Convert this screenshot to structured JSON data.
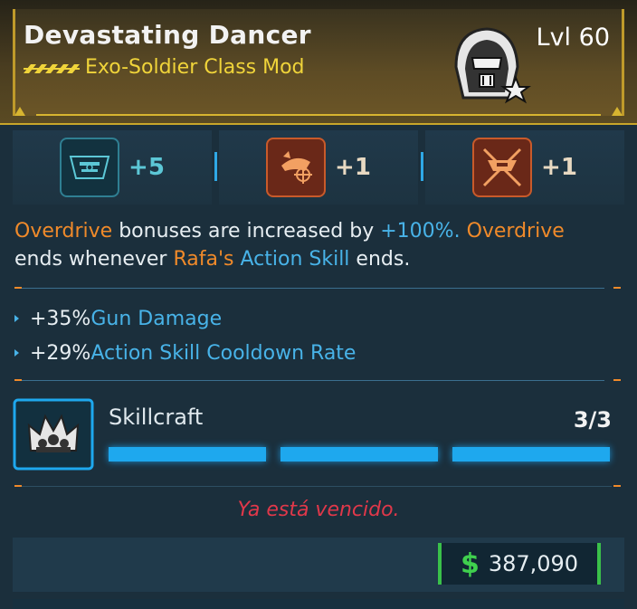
{
  "item": {
    "name": "Devastating Dancer",
    "type": "Exo-Soldier Class Mod",
    "level": "Lvl 60",
    "rarity_icon": "rarity-chevrons-icon",
    "class_emblem": "exo-soldier-helmet-icon",
    "rarity_color": "#f0d43a"
  },
  "stats": [
    {
      "icon": "skill-node-teal-icon",
      "value": "+5",
      "color": "#5cc7d6"
    },
    {
      "icon": "skill-node-orange-target-icon",
      "value": "+1",
      "color": "#e8d9c2"
    },
    {
      "icon": "skill-node-orange-crossed-icon",
      "value": "+1",
      "color": "#e8d9c2"
    }
  ],
  "description": {
    "p1_a": "Overdrive",
    "p1_b": " bonuses are increased by ",
    "p1_c": "+100%",
    "p1_d": ". ",
    "p1_e": "Overdrive",
    "p2_a": "ends whenever ",
    "p2_b": "Rafa's",
    "p2_c": " ",
    "p2_d": "Action Skill",
    "p2_e": " ends."
  },
  "bonuses": [
    {
      "amount": "+35% ",
      "label": "Gun Damage"
    },
    {
      "amount": "+29% ",
      "label": "Action Skill Cooldown Rate"
    }
  ],
  "skillcraft": {
    "label": "Skillcraft",
    "count": "3/3",
    "filled": 3,
    "total": 3,
    "icon": "skillcraft-crown-icon"
  },
  "status": {
    "expired_text": "Ya está vencido."
  },
  "price": {
    "currency_symbol": "$",
    "amount": "387,090"
  }
}
